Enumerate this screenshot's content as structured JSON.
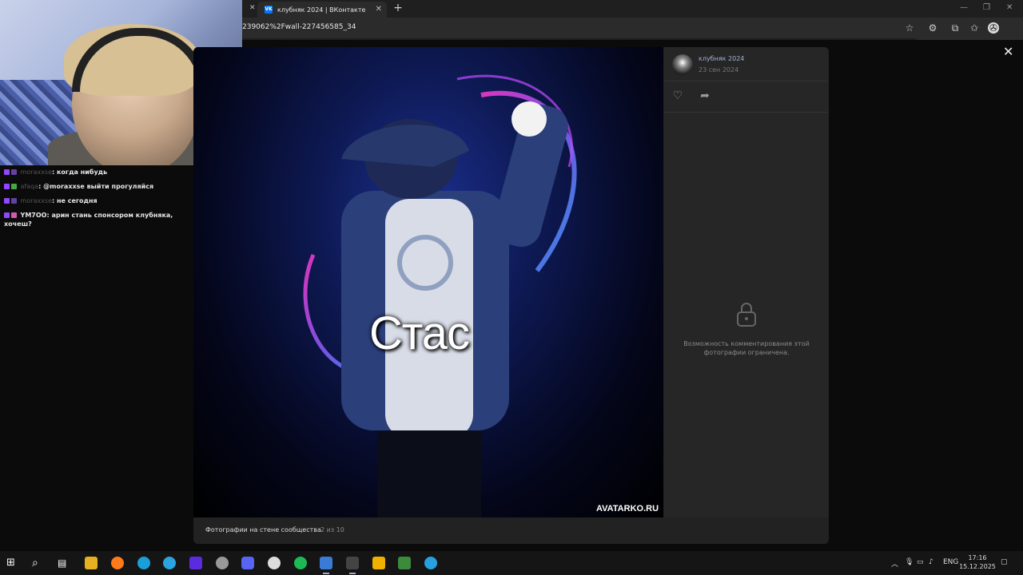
{
  "browser": {
    "tab_title": "клубняк 2024 | ВКонтакте",
    "tab_favicon": "VK",
    "url": "239062%2Fwall-227456585_34"
  },
  "chat": {
    "messages": [
      {
        "user": "moraxxse",
        "text": "когда нибудь"
      },
      {
        "user": "afaqa",
        "text": "@moraxxse выйти прогуляйся"
      },
      {
        "user": "moraxxse",
        "text": "не сегодня"
      },
      {
        "user": "YM7OO",
        "text": "арин стань спонсором клубняка, хочеш?"
      }
    ]
  },
  "viewer": {
    "photo_caption": "Стас",
    "photo_watermark": "AVATARKO.RU",
    "album_name": "Фотографии на стене сообщества",
    "album_count": "2 из 10",
    "group_name": "клубняк 2024",
    "post_date": "23 сен 2024",
    "comments_locked_message": "Возможность комментирования этой фотографии ограничена."
  },
  "taskbar": {
    "language": "ENG",
    "time": "17:16",
    "date": "15.12.2025"
  },
  "colors": {
    "vk_blue": "#0077ff",
    "viewer_bg": "#222222",
    "group_link": "#9fb4d6"
  }
}
